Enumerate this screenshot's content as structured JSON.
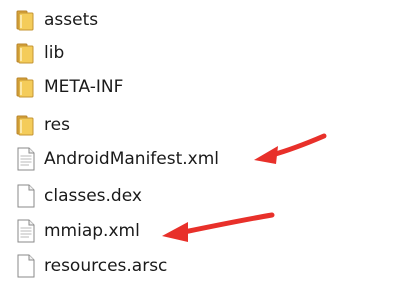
{
  "files": [
    {
      "name": "assets",
      "type": "folder",
      "icon": "folder-icon"
    },
    {
      "name": "lib",
      "type": "folder",
      "icon": "folder-icon"
    },
    {
      "name": "META-INF",
      "type": "folder",
      "icon": "folder-icon"
    },
    {
      "name": "res",
      "type": "folder",
      "icon": "folder-icon"
    },
    {
      "name": "AndroidManifest.xml",
      "type": "file",
      "icon": "document-icon"
    },
    {
      "name": "classes.dex",
      "type": "file",
      "icon": "blank-file-icon"
    },
    {
      "name": "mmiap.xml",
      "type": "file",
      "icon": "document-icon"
    },
    {
      "name": "resources.arsc",
      "type": "file",
      "icon": "blank-file-icon"
    }
  ],
  "annotations": {
    "arrow_color": "#e8302a",
    "arrows": [
      "arrow-icon",
      "arrow-icon"
    ]
  },
  "colors": {
    "folder_front": "#f2c74f",
    "folder_back": "#e0a82e",
    "file_border": "#8a8a8a"
  }
}
